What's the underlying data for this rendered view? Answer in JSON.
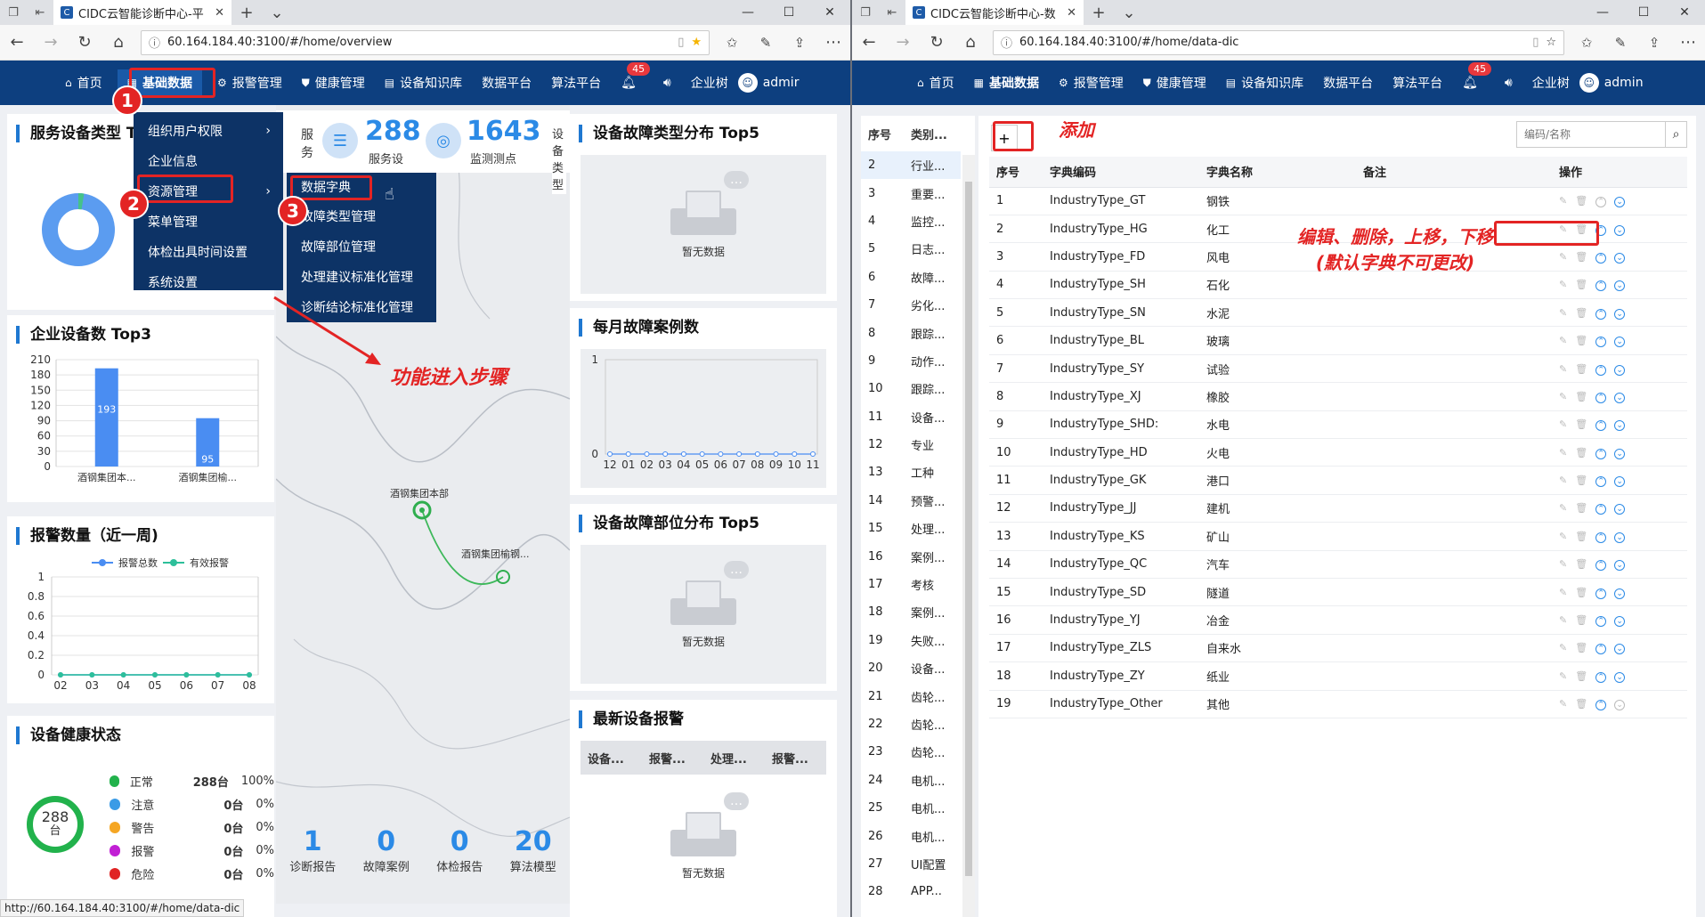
{
  "left": {
    "tab_title": "CIDC云智能诊断中心-平",
    "url": "60.164.184.40:3100/#/home/overview",
    "nav": {
      "home": "首页",
      "basic": "基础数据",
      "alarm": "报警管理",
      "health": "健康管理",
      "kb": "设备知识库",
      "data": "数据平台",
      "algo": "算法平台",
      "badge": "45",
      "company": "企业树",
      "user": "admir"
    },
    "panel_service_type": "服务设备类型 To",
    "panel_top3": "企业设备数 Top3",
    "top3": {
      "yticks": [
        "210",
        "180",
        "150",
        "120",
        "90",
        "60",
        "30",
        "0"
      ],
      "categories": [
        "酒钢集团本...",
        "酒钢集团榆..."
      ],
      "values": [
        193,
        95
      ],
      "ylim": [
        0,
        210
      ]
    },
    "panel_alarm_week": "报警数量（近一周)",
    "alarm_week": {
      "legend": [
        "报警总数",
        "有效报警"
      ],
      "yticks": [
        "1",
        "0.8",
        "0.6",
        "0.4",
        "0.2",
        "0"
      ],
      "categories": [
        "02",
        "03",
        "04",
        "05",
        "06",
        "07",
        "08"
      ],
      "total": [
        0,
        0,
        0,
        0,
        0,
        0,
        0
      ],
      "valid": [
        0,
        0,
        0,
        0,
        0,
        0,
        0
      ],
      "ylim": [
        0,
        1
      ]
    },
    "panel_health": "设备健康状态",
    "health": {
      "center_value": "288",
      "center_unit": "台",
      "rows": [
        {
          "label": "正常",
          "count": "288台",
          "pct": "100%",
          "color": "#22b24c"
        },
        {
          "label": "注意",
          "count": "0台",
          "pct": "0%",
          "color": "#3a9be6"
        },
        {
          "label": "警告",
          "count": "0台",
          "pct": "0%",
          "color": "#f5a623"
        },
        {
          "label": "报警",
          "count": "0台",
          "pct": "0%",
          "color": "#c11fd4"
        },
        {
          "label": "危险",
          "count": "0台",
          "pct": "0%",
          "color": "#e02323"
        }
      ]
    },
    "kpi": {
      "v288": "288",
      "l288": "服务设",
      "v1643": "1643",
      "l1643": "监测测点",
      "vert_left": "服\n务",
      "vert_right": "设\n备\n类\n型"
    },
    "map_labels": {
      "a": "酒钢集团本部",
      "b": "酒钢集团榆钢..."
    },
    "bottom_stats": [
      {
        "v": "1",
        "l": "诊断报告"
      },
      {
        "v": "0",
        "l": "故障案例"
      },
      {
        "v": "0",
        "l": "体检报告"
      },
      {
        "v": "20",
        "l": "算法模型"
      }
    ],
    "panel_fault_type": "设备故障类型分布 Top5",
    "no_data": "暂无数据",
    "panel_monthly": "每月故障案例数",
    "monthly": {
      "yticks": [
        "1",
        "0"
      ],
      "categories": [
        "12",
        "01",
        "02",
        "03",
        "04",
        "05",
        "06",
        "07",
        "08",
        "09",
        "10",
        "11"
      ],
      "values": [
        0,
        0,
        0,
        0,
        0,
        0,
        0,
        0,
        0,
        0,
        0,
        0
      ],
      "ylim": [
        0,
        1
      ]
    },
    "panel_fault_part": "设备故障部位分布 Top5",
    "panel_latest": "最新设备报警",
    "latest_cols": [
      "设备...",
      "报警...",
      "处理...",
      "报警..."
    ],
    "menu1": [
      "组织用户权限",
      "企业信息",
      "资源管理",
      "菜单管理",
      "体检出具时间设置",
      "系统设置"
    ],
    "menu2": [
      "数据字典",
      "故障类型管理",
      "故障部位管理",
      "处理建议标准化管理",
      "诊断结论标准化管理"
    ],
    "steps": [
      "1",
      "2",
      "3"
    ],
    "annot_steps": "功能进入步骤",
    "status_url": "http://60.164.184.40:3100/#/home/data-dic"
  },
  "right": {
    "tab_title": "CIDC云智能诊断中心-数",
    "url": "60.164.184.40:3100/#/home/data-dic",
    "nav": {
      "home": "首页",
      "basic": "基础数据",
      "alarm": "报警管理",
      "health": "健康管理",
      "kb": "设备知识库",
      "data": "数据平台",
      "algo": "算法平台",
      "badge": "45",
      "company": "企业树",
      "user": "admin"
    },
    "left_table": {
      "cols": [
        "序号",
        "类别..."
      ],
      "rows": [
        [
          "2",
          "行业..."
        ],
        [
          "3",
          "重要..."
        ],
        [
          "4",
          "监控..."
        ],
        [
          "5",
          "日志..."
        ],
        [
          "6",
          "故障..."
        ],
        [
          "7",
          "劣化..."
        ],
        [
          "8",
          "跟踪..."
        ],
        [
          "9",
          "动作..."
        ],
        [
          "10",
          "跟踪..."
        ],
        [
          "11",
          "设备..."
        ],
        [
          "12",
          "专业"
        ],
        [
          "13",
          "工种"
        ],
        [
          "14",
          "预警..."
        ],
        [
          "15",
          "处理..."
        ],
        [
          "16",
          "案例..."
        ],
        [
          "17",
          "考核"
        ],
        [
          "18",
          "案例..."
        ],
        [
          "19",
          "失败..."
        ],
        [
          "20",
          "设备..."
        ],
        [
          "21",
          "齿轮..."
        ],
        [
          "22",
          "齿轮..."
        ],
        [
          "23",
          "齿轮..."
        ],
        [
          "24",
          "电机..."
        ],
        [
          "25",
          "电机..."
        ],
        [
          "26",
          "电机..."
        ],
        [
          "27",
          "UI配置"
        ],
        [
          "28",
          "APP..."
        ]
      ]
    },
    "add_button": "+",
    "annot_add": "添加",
    "search_placeholder": "编码/名称",
    "table": {
      "cols": [
        "序号",
        "字典编码",
        "字典名称",
        "备注",
        "操作"
      ],
      "rows": [
        [
          "1",
          "IndustryType_GT",
          "钢铁",
          ""
        ],
        [
          "2",
          "IndustryType_HG",
          "化工",
          ""
        ],
        [
          "3",
          "IndustryType_FD",
          "风电",
          ""
        ],
        [
          "4",
          "IndustryType_SH",
          "石化",
          ""
        ],
        [
          "5",
          "IndustryType_SN",
          "水泥",
          ""
        ],
        [
          "6",
          "IndustryType_BL",
          "玻璃",
          ""
        ],
        [
          "7",
          "IndustryType_SY",
          "试验",
          ""
        ],
        [
          "8",
          "IndustryType_XJ",
          "橡胶",
          ""
        ],
        [
          "9",
          "IndustryType_SHD:",
          "水电",
          ""
        ],
        [
          "10",
          "IndustryType_HD",
          "火电",
          ""
        ],
        [
          "11",
          "IndustryType_GK",
          "港口",
          ""
        ],
        [
          "12",
          "IndustryType_JJ",
          "建机",
          ""
        ],
        [
          "13",
          "IndustryType_KS",
          "矿山",
          ""
        ],
        [
          "14",
          "IndustryType_QC",
          "汽车",
          ""
        ],
        [
          "15",
          "IndustryType_SD",
          "隧道",
          ""
        ],
        [
          "16",
          "IndustryType_YJ",
          "冶金",
          ""
        ],
        [
          "17",
          "IndustryType_ZLS",
          "自来水",
          ""
        ],
        [
          "18",
          "IndustryType_ZY",
          "纸业",
          ""
        ],
        [
          "19",
          "IndustryType_Other",
          "其他",
          ""
        ]
      ]
    },
    "annot_ops_1": "编辑、删除，上移，下移",
    "annot_ops_2": "(默认字典不可更改)"
  }
}
